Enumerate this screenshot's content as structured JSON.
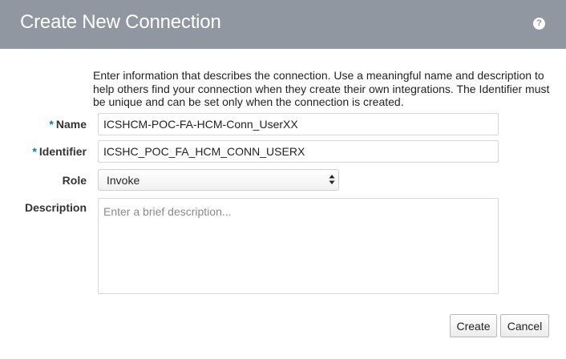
{
  "dialog": {
    "title": "Create New Connection",
    "help_icon": "help-icon",
    "help_glyph": "?"
  },
  "intro_text": "Enter information that describes the connection. Use a meaningful name and description to help others find your connection when they create their own integrations. The Identifier must be unique and can be set only when the connection is created.",
  "form": {
    "required_marker": "*",
    "name": {
      "label": "Name",
      "value": "ICSHCM-POC-FA-HCM-Conn_UserXX"
    },
    "identifier": {
      "label": "Identifier",
      "value": "ICSHC_POC_FA_HCM_CONN_USERX"
    },
    "role": {
      "label": "Role",
      "selected": "Invoke",
      "icon": "updown-chevron-icon"
    },
    "description": {
      "label": "Description",
      "placeholder": "Enter a brief description...",
      "value": ""
    }
  },
  "buttons": {
    "create_label": "Create",
    "cancel_label": "Cancel"
  },
  "colors": {
    "titlebar": "#9097a0",
    "required_marker": "#1f6fb6",
    "background": "#ffffff"
  }
}
